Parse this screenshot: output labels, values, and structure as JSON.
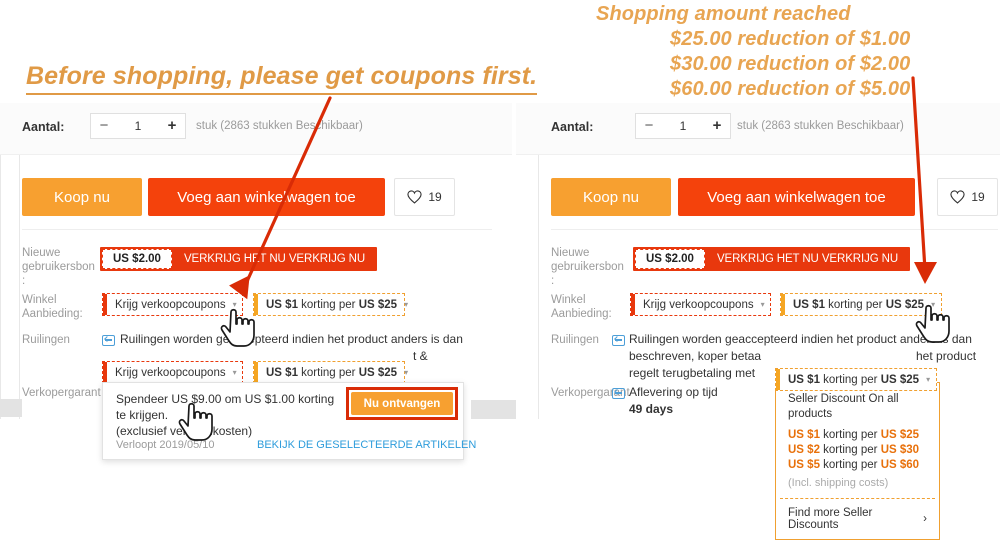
{
  "annotations": {
    "left": "Before shopping, please get coupons first.",
    "right_title": "Shopping amount reached",
    "right_lines": [
      "$25.00 reduction of $1.00",
      "$30.00 reduction of $2.00",
      "$60.00 reduction of $5.00"
    ]
  },
  "colors": {
    "annotation": "#e09a46",
    "arrow_red": "#d92b06",
    "buy_now": "#f7a030",
    "add_cart": "#f4420c",
    "coupon_red": "#e8380d",
    "discount_orange": "#e8700a",
    "link_blue": "#2d9cdb"
  },
  "product": {
    "qty_label": "Aantal:",
    "qty_minus": "−",
    "qty_value": "1",
    "qty_plus": "+",
    "stock_text": "stuk (2863 stukken Beschikbaar)",
    "buy_now_label": "Koop nu",
    "add_to_cart_label": "Voeg aan winkelwagen toe",
    "wishlist_count": "19",
    "rows": {
      "new_user_label": "Nieuwe\ngebruikersbon\n:",
      "store_offer_label": "Winkel\nAanbieding:",
      "exchange_label": "Ruilingen",
      "seller_guarantee_label": "Verkopergarant"
    },
    "new_user_coupon": {
      "amount": "US $2.00",
      "action": "VERKRIJG HET NU VERKRIJG NU"
    },
    "coupon_chip": {
      "label": "Krijg verkoopcoupons",
      "caret": "▾"
    },
    "discount_chip": {
      "prefix": "US $1",
      "middle": " korting per ",
      "suffix": "US $25",
      "caret": "▾"
    },
    "exchange_left": "Ruilingen worden geaccepteerd indien het product anders is dan",
    "exchange_left_tail": "t &",
    "exchange_right_l1": "Ruilingen worden geaccepteerd indien het product anders is dan",
    "exchange_right_l2": "beschreven, koper betaa",
    "exchange_right_l2b": "het product",
    "exchange_right_l3": "regelt terugbetaling met",
    "delivery_label": "Aflevering op tijd",
    "delivery_value": "49 days"
  },
  "coupon_popup": {
    "line1": "Spendeer US $9.00 om US $1.00 korting te",
    "line2": "krijgen.",
    "line3": "(exclusief verzendkosten)",
    "expiry": "Verloopt 2019/05/10",
    "link": "BEKIJK DE GESELECTEERDE ARTIKELEN",
    "get_now": "Nu ontvangen"
  },
  "seller_popup": {
    "title": "Seller Discount On all products",
    "tiers": [
      {
        "amount": "US $1",
        "text": " korting per ",
        "threshold": "US $25"
      },
      {
        "amount": "US $2",
        "text": " korting per ",
        "threshold": "US $30"
      },
      {
        "amount": "US $5",
        "text": " korting per ",
        "threshold": "US $60"
      }
    ],
    "note": "(Incl. shipping costs)",
    "more": "Find more Seller Discounts",
    "more_caret": "›"
  }
}
